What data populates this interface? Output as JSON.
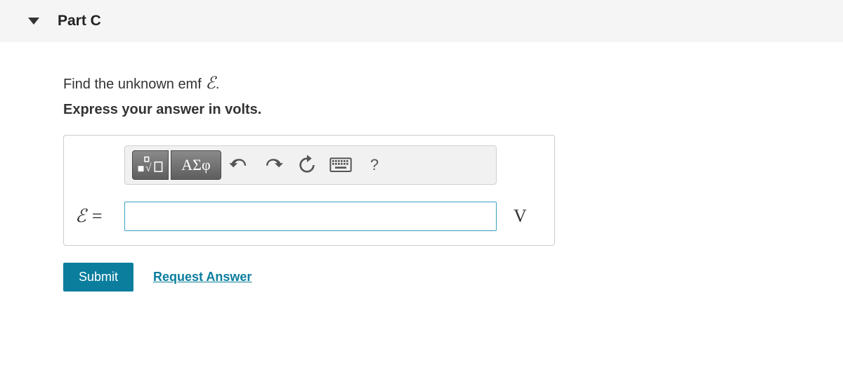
{
  "header": {
    "part_label": "Part C"
  },
  "question": {
    "prompt_prefix": "Find the unknown emf ",
    "prompt_symbol": "ℰ",
    "prompt_suffix": ".",
    "instruction": "Express your answer in volts."
  },
  "toolbar": {
    "templates_label": "",
    "greek_label": "ΑΣφ",
    "help_label": "?"
  },
  "answer": {
    "lhs_symbol": "ℰ",
    "lhs_eq": " = ",
    "value": "",
    "unit": "V"
  },
  "actions": {
    "submit_label": "Submit",
    "request_label": "Request Answer"
  }
}
